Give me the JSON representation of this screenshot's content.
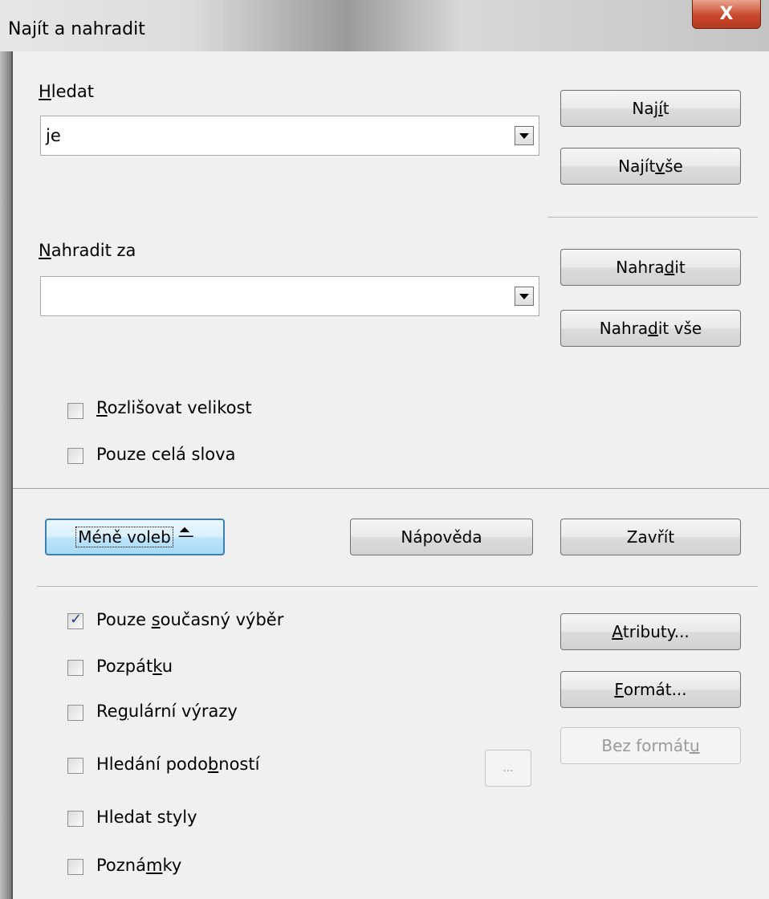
{
  "window": {
    "title": "Najít a nahradit",
    "close_glyph": "X"
  },
  "search": {
    "label_u": "H",
    "label_rest": "ledat",
    "value": "je"
  },
  "replace": {
    "label_u": "N",
    "label_rest": "ahradit za",
    "value": ""
  },
  "buttons": {
    "find": {
      "pre": "Naj",
      "u": "í",
      "post": "t"
    },
    "find_all": {
      "pre": "Najít ",
      "u": "v",
      "post": "še"
    },
    "replace": {
      "pre": "Nahra",
      "u": "d",
      "post": "it"
    },
    "replace_all": {
      "pre": "Nahra",
      "u": "d",
      "post": "it vše"
    },
    "fewer_options": "Méně voleb",
    "help": "Nápověda",
    "close": "Zavřít",
    "attributes": {
      "pre": "",
      "u": "A",
      "post": "tributy..."
    },
    "format": {
      "pre": "",
      "u": "F",
      "post": "ormát..."
    },
    "no_format": {
      "pre": "Bez formát",
      "u": "u",
      "post": ""
    },
    "ellipsis": "..."
  },
  "options": {
    "match_case": {
      "pre": "",
      "u": "R",
      "post": "ozlišovat velikost",
      "checked": false
    },
    "whole_words": {
      "pre": "Pouze celá slova",
      "u": "",
      "post": "",
      "checked": false
    }
  },
  "more_options": {
    "current_selection": {
      "pre": "Pouze ",
      "u": "s",
      "post": "oučasný výběr",
      "checked": true
    },
    "backwards": {
      "pre": "Pozpát",
      "u": "k",
      "post": "u",
      "checked": false
    },
    "regex": {
      "pre": "Re",
      "u": "g",
      "post": "ulární výrazy",
      "checked": false
    },
    "similarity": {
      "pre": "Hledání podo",
      "u": "b",
      "post": "ností",
      "checked": false
    },
    "styles": {
      "pre": "Hledat styly",
      "u": "",
      "post": "",
      "checked": false
    },
    "notes": {
      "pre": "Pozná",
      "u": "m",
      "post": "ky",
      "checked": false
    }
  }
}
